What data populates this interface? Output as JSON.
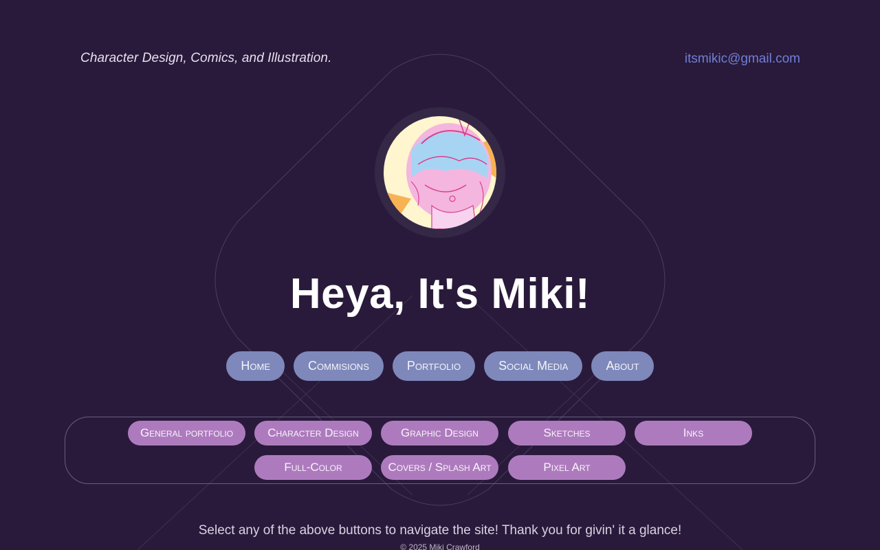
{
  "header": {
    "tagline": "Character Design, Comics, and Illustration.",
    "email": "itsmikic@gmail.com"
  },
  "hero": {
    "title": "Heya, It's Miki!"
  },
  "nav": {
    "items": [
      {
        "label": "Home"
      },
      {
        "label": "Commisions"
      },
      {
        "label": "Portfolio"
      },
      {
        "label": "Social Media"
      },
      {
        "label": "About"
      }
    ]
  },
  "portfolio_links": {
    "items": [
      {
        "label": "General portfolio"
      },
      {
        "label": "Character Design"
      },
      {
        "label": "Graphic Design"
      },
      {
        "label": "Sketches"
      },
      {
        "label": "Inks"
      },
      {
        "label": "Full-Color"
      },
      {
        "label": "Covers / Splash Art"
      },
      {
        "label": "Pixel Art"
      }
    ]
  },
  "footer": {
    "note": "Select any of the above buttons to navigate the site! Thank you for givin' it a glance!",
    "copyright": "© 2025 Miki Crawford"
  },
  "colors": {
    "background": "#291a3b",
    "nav_button": "#7e88ba",
    "portfolio_button": "#ad7bbd",
    "email_link": "#6f7fd6"
  }
}
